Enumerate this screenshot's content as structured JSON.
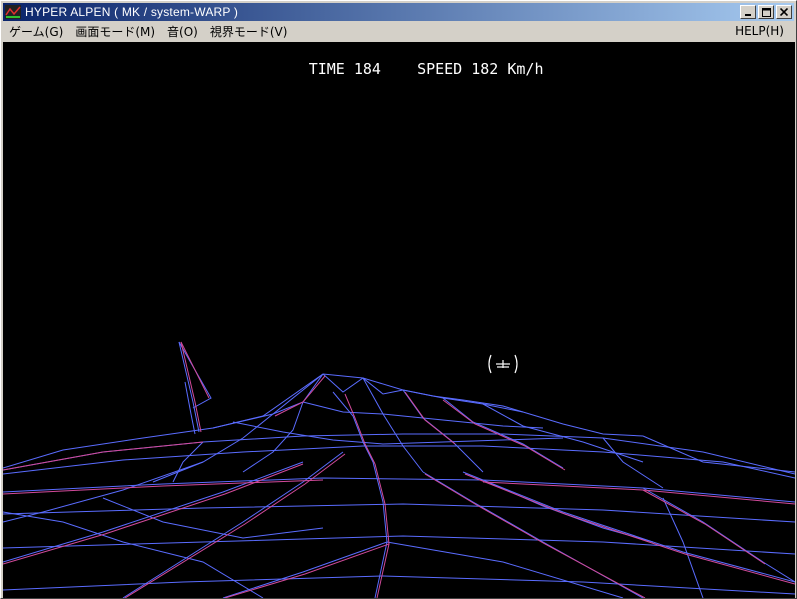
{
  "window": {
    "title": "HYPER ALPEN ( MK / system-WARP )",
    "buttons": {
      "minimize": "_",
      "maximize": "□",
      "close": "×"
    }
  },
  "menu": {
    "items": [
      "ゲーム(G)",
      "画面モード(M)",
      "音(O)",
      "視界モード(V)"
    ],
    "help": "HELP(H)"
  },
  "hud": {
    "time_label": "TIME",
    "time_value": "184",
    "speed_label": "SPEED",
    "speed_value": "182",
    "speed_unit": "Km/h"
  },
  "colors": {
    "wire_primary": "#5a6cff",
    "wire_secondary": "#d24a9a",
    "background": "#000000",
    "titlebar_start": "#0a246a",
    "titlebar_end": "#a6caf0"
  },
  "icons": {
    "app": "app-icon",
    "crosshair": "crosshair-icon"
  }
}
